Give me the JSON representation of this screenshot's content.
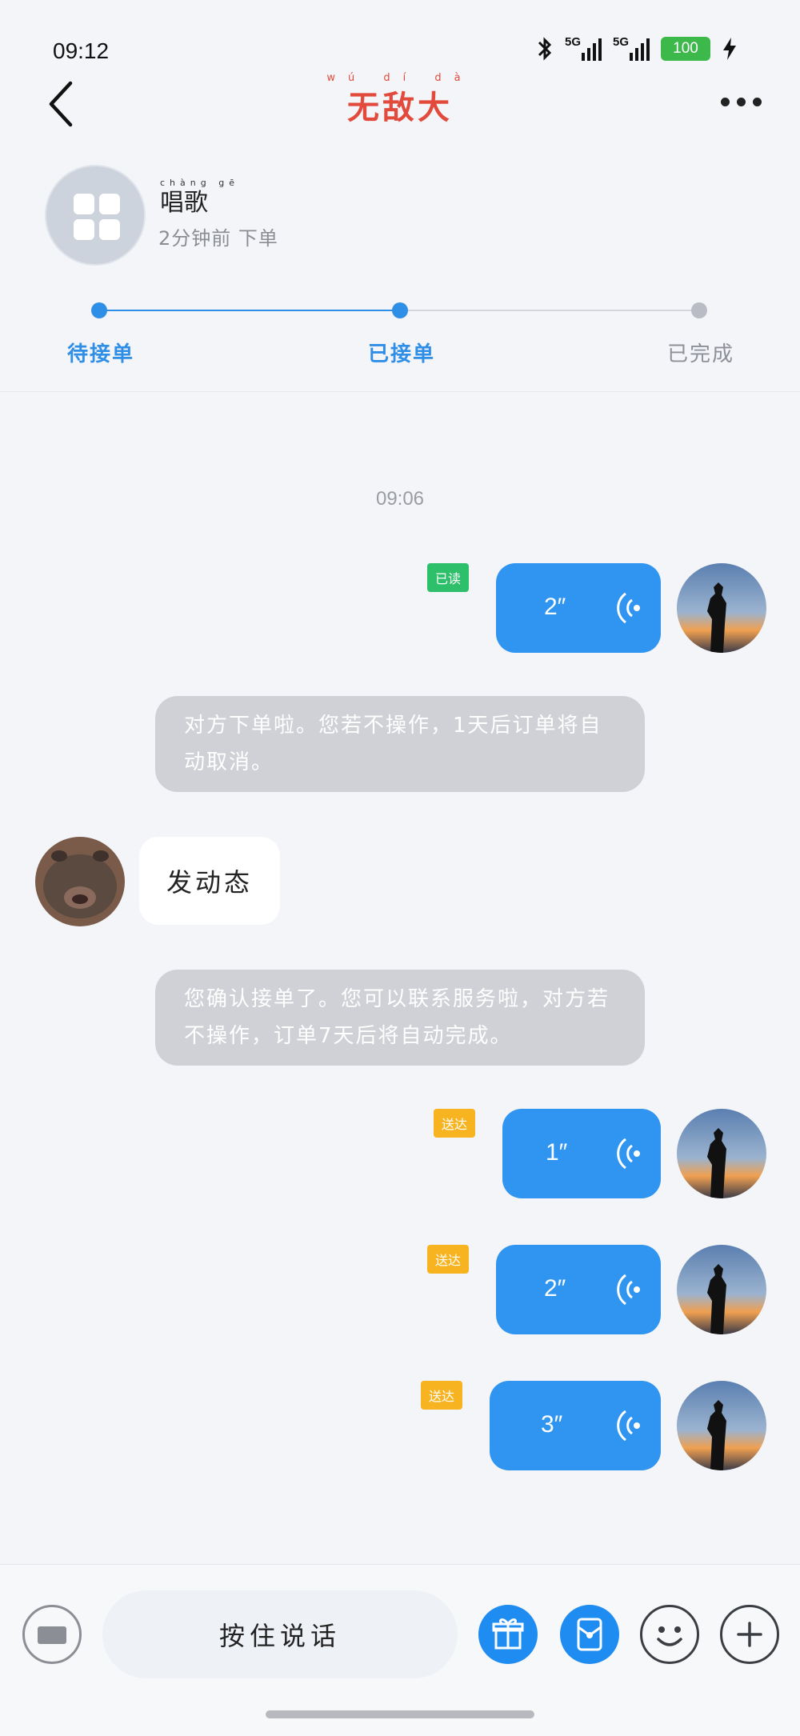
{
  "status_bar": {
    "time": "09:12",
    "network1": "5G",
    "network2": "5G",
    "battery": "100",
    "icons": [
      "bluetooth-icon",
      "signal-icon",
      "signal-icon",
      "battery-icon",
      "charging-icon"
    ]
  },
  "header": {
    "title": "无敌大",
    "title_pinyin": "wú dí dà",
    "back_icon": "chevron-left-icon",
    "more_icon": "more-dots-icon"
  },
  "order": {
    "name": "唱歌",
    "name_pinyin": "chàng gē",
    "time_text": "2分钟前 下单",
    "steps": [
      {
        "label": "待接单",
        "active": true
      },
      {
        "label": "已接单",
        "active": true
      },
      {
        "label": "已完成",
        "active": false
      }
    ],
    "colors": {
      "active": "#2f8ee6",
      "inactive": "#b9bcc4"
    }
  },
  "chat": {
    "timestamp": "09:06",
    "messages": [
      {
        "type": "voice",
        "side": "self",
        "duration": "2″",
        "status": "已读"
      },
      {
        "type": "system",
        "text": "对方下单啦。您若不操作，1天后订单将自动取消。"
      },
      {
        "type": "text",
        "side": "other",
        "text": "发动态"
      },
      {
        "type": "system",
        "text": "您确认接单了。您可以联系服务啦，对方若不操作，订单7天后将自动完成。"
      },
      {
        "type": "voice",
        "side": "self",
        "duration": "1″",
        "status": "送达"
      },
      {
        "type": "voice",
        "side": "self",
        "duration": "2″",
        "status": "送达"
      },
      {
        "type": "voice",
        "side": "self",
        "duration": "3″",
        "status": "送达"
      }
    ]
  },
  "input_bar": {
    "hold_to_talk": "按住说话",
    "icons": [
      "keyboard-icon",
      "gift-icon",
      "red-packet-icon",
      "emoji-icon",
      "plus-icon"
    ]
  }
}
